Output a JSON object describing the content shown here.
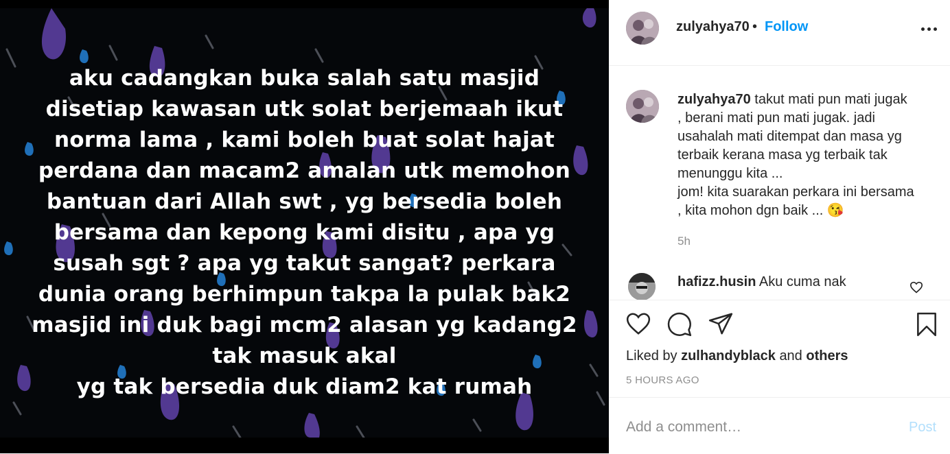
{
  "post_image": {
    "text_lines": [
      "aku cadangkan buka salah satu masjid",
      "disetiap kawasan utk solat berjemaah ikut",
      "norma lama , kami boleh buat solat hajat",
      "perdana dan macam2 amalan utk memohon",
      "bantuan dari Allah swt , yg bersedia boleh",
      "bersama dan kepong kami disitu , apa yg",
      "susah sgt ? apa yg takut sangat? perkara",
      "dunia orang berhimpun takpa la pulak bak2",
      "masjid ini duk bagi mcm2 alasan yg kadang2",
      "tak masuk akal",
      "yg tak bersedia duk diam2 kat rumah"
    ],
    "background_color": "#05070a",
    "raindrop_colors": [
      "#5b3fa0",
      "#1f6fb8"
    ]
  },
  "header": {
    "username": "zulyahya70",
    "separator": "•",
    "follow_label": "Follow",
    "more_icon": "more-horizontal-icon"
  },
  "caption": {
    "username": "zulyahya70",
    "lines": [
      "takut mati pun mati jugak",
      ", berani mati pun mati jugak. jadi",
      "usahalah mati ditempat dan masa yg",
      "terbaik kerana masa yg terbaik tak",
      "menunggu kita ...",
      "jom! kita suarakan perkara ini bersama",
      ", kita mohon dgn baik ... "
    ],
    "emoji": "😘",
    "time": "5h"
  },
  "comment": {
    "username": "hafizz.husin",
    "text": "Aku cuma nak"
  },
  "actions": {
    "liked_by_prefix": "Liked by",
    "liked_by_user": "zulhandyblack",
    "and_label": "and",
    "others_label": "others",
    "posted_time": "5 HOURS AGO"
  },
  "add_comment": {
    "placeholder": "Add a comment…",
    "post_label": "Post"
  },
  "colors": {
    "accent": "#0095f6",
    "post_disabled": "#b2dffc",
    "text": "#262626",
    "muted": "#8e8e8e"
  }
}
